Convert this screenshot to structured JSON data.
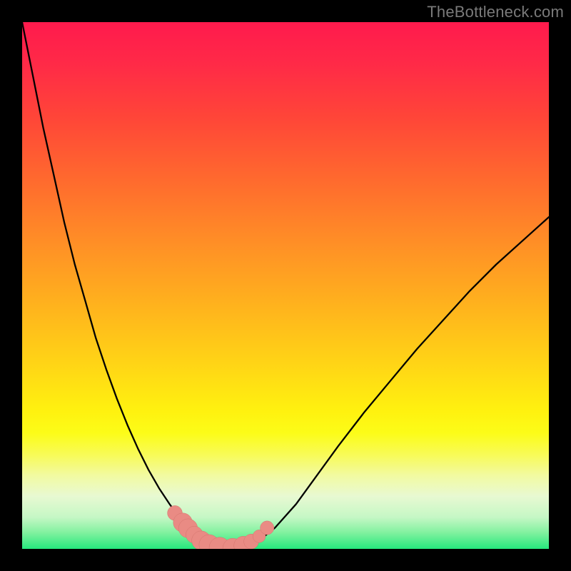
{
  "watermark": "TheBottleneck.com",
  "colors": {
    "curve": "#000000",
    "marker_fill": "#e98b84",
    "marker_stroke": "#d4746d",
    "gradient_top": "#ff1a4d",
    "gradient_bottom": "#26e87d"
  },
  "chart_data": {
    "type": "line",
    "title": "",
    "xlabel": "",
    "ylabel": "",
    "xlim": [
      0,
      100
    ],
    "ylim": [
      0,
      100
    ],
    "grid": false,
    "series": [
      {
        "name": "bottleneck-curve",
        "x": [
          0,
          2,
          4,
          6,
          8,
          10,
          12,
          14,
          16,
          18,
          20,
          22,
          24,
          26,
          28,
          30,
          31,
          32,
          33,
          34,
          35,
          36,
          38,
          40,
          42,
          45,
          48,
          52,
          56,
          60,
          65,
          70,
          75,
          80,
          85,
          90,
          95,
          100
        ],
        "y": [
          100,
          90,
          80,
          71,
          62,
          54,
          47,
          40,
          34,
          28.5,
          23.5,
          19,
          15,
          11.5,
          8.5,
          5.8,
          4.6,
          3.6,
          2.7,
          1.9,
          1.2,
          0.6,
          0.1,
          0.0,
          0.3,
          1.6,
          4.0,
          8.5,
          14,
          19.5,
          26,
          32,
          38,
          43.5,
          49,
          54,
          58.5,
          63
        ],
        "note": "y is percent height from bottom of gradient area (0 = bottom/green, 100 = top/red). Values estimated visually — no axis ticks present in image."
      }
    ],
    "markers": [
      {
        "x": 29.0,
        "y": 6.8,
        "r": 1.0
      },
      {
        "x": 30.5,
        "y": 5.0,
        "r": 1.4
      },
      {
        "x": 31.5,
        "y": 3.9,
        "r": 1.4
      },
      {
        "x": 32.7,
        "y": 2.7,
        "r": 1.2
      },
      {
        "x": 34.0,
        "y": 1.6,
        "r": 1.4
      },
      {
        "x": 35.5,
        "y": 0.8,
        "r": 1.5
      },
      {
        "x": 37.5,
        "y": 0.2,
        "r": 1.6
      },
      {
        "x": 40.0,
        "y": 0.1,
        "r": 1.5
      },
      {
        "x": 42.0,
        "y": 0.6,
        "r": 1.4
      },
      {
        "x": 43.5,
        "y": 1.4,
        "r": 1.0
      },
      {
        "x": 45.0,
        "y": 2.4,
        "r": 0.8
      },
      {
        "x": 46.5,
        "y": 4.0,
        "r": 0.9
      }
    ]
  }
}
